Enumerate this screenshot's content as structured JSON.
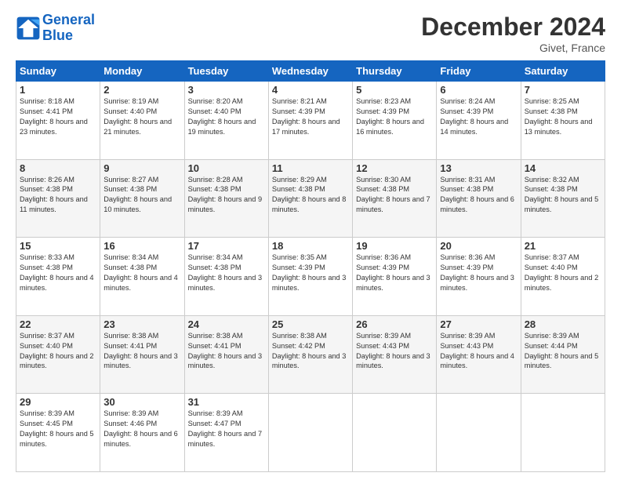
{
  "logo": {
    "line1": "General",
    "line2": "Blue"
  },
  "title": "December 2024",
  "location": "Givet, France",
  "days_of_week": [
    "Sunday",
    "Monday",
    "Tuesday",
    "Wednesday",
    "Thursday",
    "Friday",
    "Saturday"
  ],
  "weeks": [
    [
      {
        "day": "1",
        "sunrise": "8:18 AM",
        "sunset": "4:41 PM",
        "daylight": "8 hours and 23 minutes."
      },
      {
        "day": "2",
        "sunrise": "8:19 AM",
        "sunset": "4:40 PM",
        "daylight": "8 hours and 21 minutes."
      },
      {
        "day": "3",
        "sunrise": "8:20 AM",
        "sunset": "4:40 PM",
        "daylight": "8 hours and 19 minutes."
      },
      {
        "day": "4",
        "sunrise": "8:21 AM",
        "sunset": "4:39 PM",
        "daylight": "8 hours and 17 minutes."
      },
      {
        "day": "5",
        "sunrise": "8:23 AM",
        "sunset": "4:39 PM",
        "daylight": "8 hours and 16 minutes."
      },
      {
        "day": "6",
        "sunrise": "8:24 AM",
        "sunset": "4:39 PM",
        "daylight": "8 hours and 14 minutes."
      },
      {
        "day": "7",
        "sunrise": "8:25 AM",
        "sunset": "4:38 PM",
        "daylight": "8 hours and 13 minutes."
      }
    ],
    [
      {
        "day": "8",
        "sunrise": "8:26 AM",
        "sunset": "4:38 PM",
        "daylight": "8 hours and 11 minutes."
      },
      {
        "day": "9",
        "sunrise": "8:27 AM",
        "sunset": "4:38 PM",
        "daylight": "8 hours and 10 minutes."
      },
      {
        "day": "10",
        "sunrise": "8:28 AM",
        "sunset": "4:38 PM",
        "daylight": "8 hours and 9 minutes."
      },
      {
        "day": "11",
        "sunrise": "8:29 AM",
        "sunset": "4:38 PM",
        "daylight": "8 hours and 8 minutes."
      },
      {
        "day": "12",
        "sunrise": "8:30 AM",
        "sunset": "4:38 PM",
        "daylight": "8 hours and 7 minutes."
      },
      {
        "day": "13",
        "sunrise": "8:31 AM",
        "sunset": "4:38 PM",
        "daylight": "8 hours and 6 minutes."
      },
      {
        "day": "14",
        "sunrise": "8:32 AM",
        "sunset": "4:38 PM",
        "daylight": "8 hours and 5 minutes."
      }
    ],
    [
      {
        "day": "15",
        "sunrise": "8:33 AM",
        "sunset": "4:38 PM",
        "daylight": "8 hours and 4 minutes."
      },
      {
        "day": "16",
        "sunrise": "8:34 AM",
        "sunset": "4:38 PM",
        "daylight": "8 hours and 4 minutes."
      },
      {
        "day": "17",
        "sunrise": "8:34 AM",
        "sunset": "4:38 PM",
        "daylight": "8 hours and 3 minutes."
      },
      {
        "day": "18",
        "sunrise": "8:35 AM",
        "sunset": "4:39 PM",
        "daylight": "8 hours and 3 minutes."
      },
      {
        "day": "19",
        "sunrise": "8:36 AM",
        "sunset": "4:39 PM",
        "daylight": "8 hours and 3 minutes."
      },
      {
        "day": "20",
        "sunrise": "8:36 AM",
        "sunset": "4:39 PM",
        "daylight": "8 hours and 3 minutes."
      },
      {
        "day": "21",
        "sunrise": "8:37 AM",
        "sunset": "4:40 PM",
        "daylight": "8 hours and 2 minutes."
      }
    ],
    [
      {
        "day": "22",
        "sunrise": "8:37 AM",
        "sunset": "4:40 PM",
        "daylight": "8 hours and 2 minutes."
      },
      {
        "day": "23",
        "sunrise": "8:38 AM",
        "sunset": "4:41 PM",
        "daylight": "8 hours and 3 minutes."
      },
      {
        "day": "24",
        "sunrise": "8:38 AM",
        "sunset": "4:41 PM",
        "daylight": "8 hours and 3 minutes."
      },
      {
        "day": "25",
        "sunrise": "8:38 AM",
        "sunset": "4:42 PM",
        "daylight": "8 hours and 3 minutes."
      },
      {
        "day": "26",
        "sunrise": "8:39 AM",
        "sunset": "4:43 PM",
        "daylight": "8 hours and 3 minutes."
      },
      {
        "day": "27",
        "sunrise": "8:39 AM",
        "sunset": "4:43 PM",
        "daylight": "8 hours and 4 minutes."
      },
      {
        "day": "28",
        "sunrise": "8:39 AM",
        "sunset": "4:44 PM",
        "daylight": "8 hours and 5 minutes."
      }
    ],
    [
      {
        "day": "29",
        "sunrise": "8:39 AM",
        "sunset": "4:45 PM",
        "daylight": "8 hours and 5 minutes."
      },
      {
        "day": "30",
        "sunrise": "8:39 AM",
        "sunset": "4:46 PM",
        "daylight": "8 hours and 6 minutes."
      },
      {
        "day": "31",
        "sunrise": "8:39 AM",
        "sunset": "4:47 PM",
        "daylight": "8 hours and 7 minutes."
      },
      null,
      null,
      null,
      null
    ]
  ]
}
